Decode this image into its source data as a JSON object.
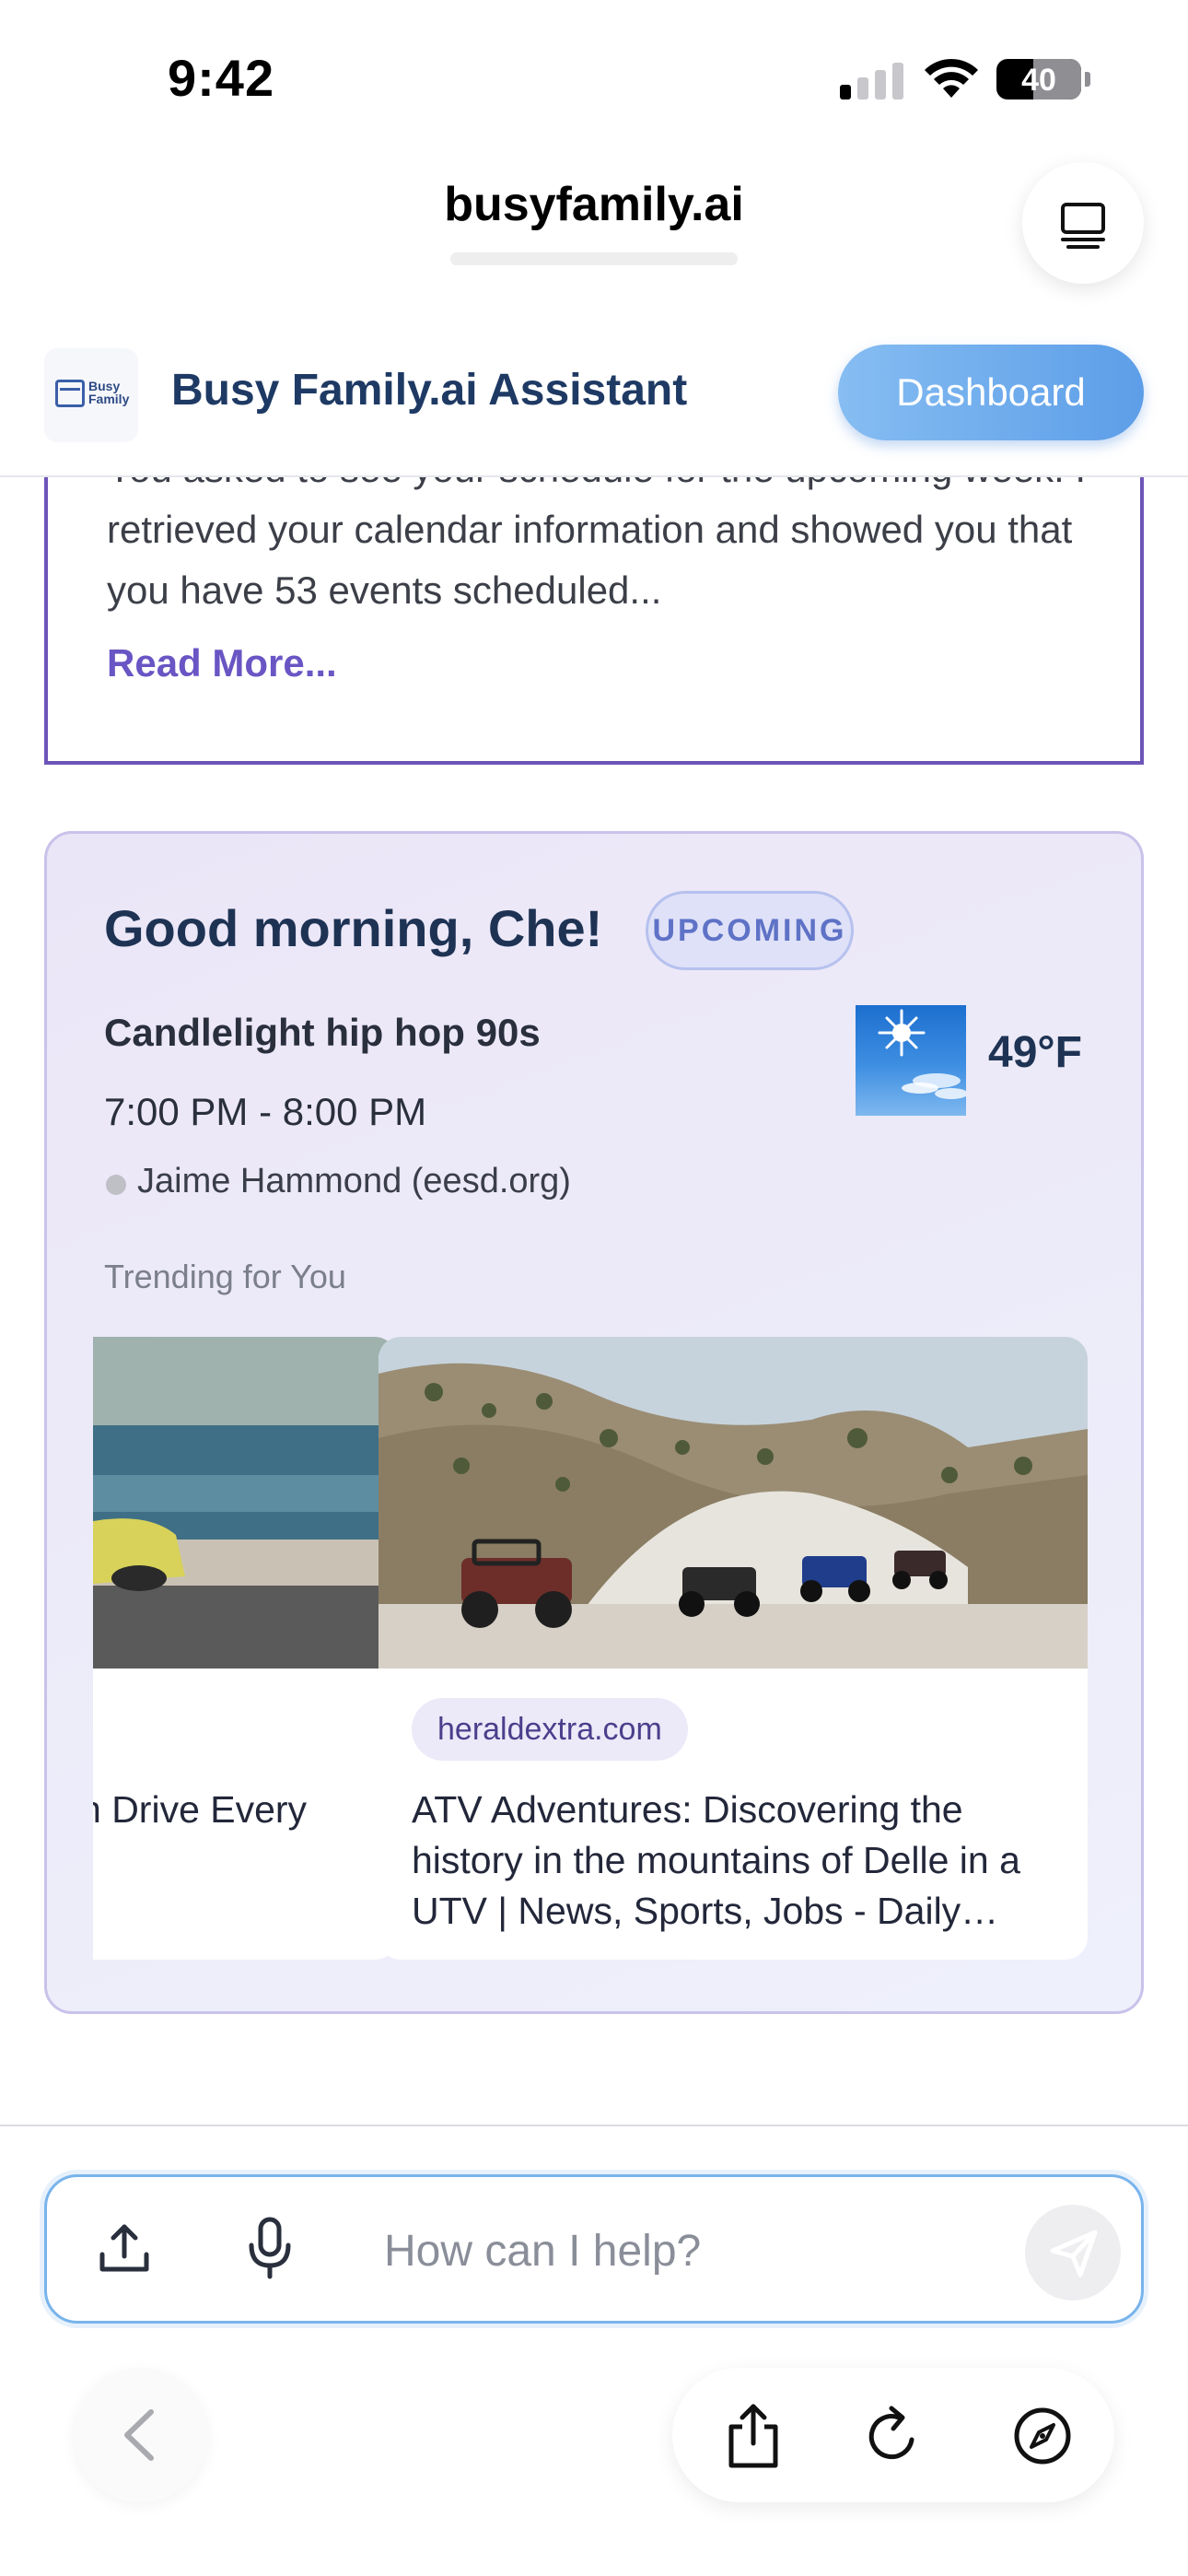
{
  "status_bar": {
    "time": "9:42",
    "battery": "40"
  },
  "browser": {
    "url": "busyfamily.ai"
  },
  "header": {
    "logo_text_line1": "Busy",
    "logo_text_line2": "Family",
    "title": "Busy Family.ai Assistant",
    "dashboard_label": "Dashboard"
  },
  "summary": {
    "text": "You asked to see your schedule for the upcoming week. I retrieved your calendar information and showed you that you have 53 events scheduled...",
    "read_more": "Read More..."
  },
  "greeting_card": {
    "greeting": "Good morning, Che!",
    "badge": "UPCOMING",
    "event_title": "Candlelight hip hop 90s",
    "event_time": "7:00 PM - 8:00 PM",
    "organizer": "Jaime Hammond (eesd.org)",
    "temperature": "49°F",
    "weather_icon": "sunny-sky"
  },
  "trending": {
    "label": "Trending for You",
    "items": [
      {
        "title_line1": "n Drive Every",
        "image": "car-by-ocean"
      },
      {
        "source": "heraldextra.com",
        "title": "ATV Adventures: Discovering the history in the mountains of Delle in a UTV | News, Sports, Jobs - Daily…",
        "image": "utvs-on-dirt-trail"
      }
    ]
  },
  "composer": {
    "placeholder": "How can I help?"
  },
  "colors": {
    "accent_purple": "#6d55b8",
    "dashboard_blue": "#5d9ee8",
    "title_navy": "#1e3a64"
  }
}
